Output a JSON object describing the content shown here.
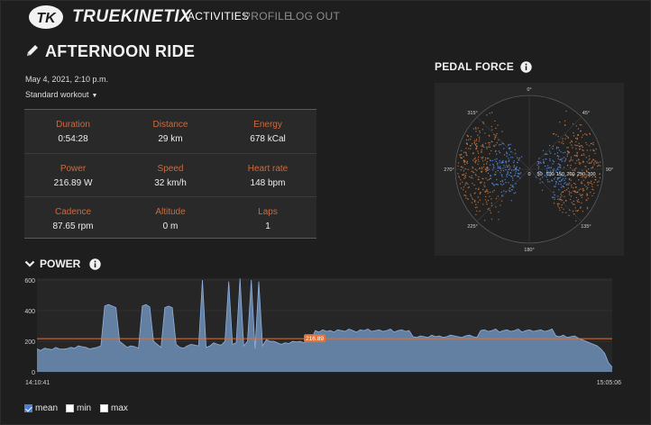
{
  "header": {
    "logo_text": "TK",
    "brand": "TRUEKINETIX",
    "nav": [
      {
        "label": "ACTIVITIES",
        "active": true
      },
      {
        "label": "PROFILE",
        "active": false
      },
      {
        "label": "LOG OUT",
        "active": false
      }
    ]
  },
  "activity": {
    "title": "AFTERNOON RIDE",
    "date": "May 4, 2021, 2:10 p.m.",
    "workout_type": "Standard workout"
  },
  "stats": [
    [
      {
        "label": "Duration",
        "value": "0:54:28"
      },
      {
        "label": "Distance",
        "value": "29 km"
      },
      {
        "label": "Energy",
        "value": "678 kCal"
      }
    ],
    [
      {
        "label": "Power",
        "value": "216.89 W"
      },
      {
        "label": "Speed",
        "value": "32 km/h"
      },
      {
        "label": "Heart rate",
        "value": "148 bpm"
      }
    ],
    [
      {
        "label": "Cadence",
        "value": "87.65 rpm"
      },
      {
        "label": "Altitude",
        "value": "0 m"
      },
      {
        "label": "Laps",
        "value": "1"
      }
    ]
  ],
  "pedal_force": {
    "title": "PEDAL FORCE",
    "info_icon": "info-icon",
    "angle_labels": [
      "0°",
      "45°",
      "90°",
      "135°",
      "180°",
      "225°",
      "270°",
      "315°"
    ],
    "radial_labels": [
      "0",
      "50",
      "100",
      "150",
      "200",
      "250",
      "300"
    ],
    "colors": {
      "left": "#d9844a",
      "right": "#5b8fe0"
    }
  },
  "power": {
    "title": "POWER",
    "collapse_icon": "chevron-down-icon",
    "info_icon": "info-icon",
    "legend": [
      {
        "label": "mean",
        "checked": true
      },
      {
        "label": "min",
        "checked": false
      },
      {
        "label": "max",
        "checked": false
      }
    ]
  },
  "chart_data": {
    "type": "area",
    "title": "",
    "xlabel": "",
    "ylabel": "",
    "ylim": [
      0,
      600
    ],
    "y_ticks": [
      "0",
      "200",
      "400",
      "600"
    ],
    "x_tick_labels": [
      "14:10:41",
      "15:05:06"
    ],
    "mean_value": 216.89,
    "mean_label": "216.89",
    "colors": {
      "fill": "#6f8fb8",
      "line": "#8fb0e0",
      "mean": "#e0733a"
    },
    "series": [
      {
        "values": [
          150,
          140,
          155,
          150,
          145,
          160,
          150,
          148,
          152,
          160,
          155,
          170,
          165,
          160,
          150,
          155,
          160,
          170,
          430,
          440,
          430,
          420,
          200,
          180,
          160,
          170,
          165,
          155,
          430,
          440,
          425,
          200,
          180,
          160,
          420,
          430,
          420,
          180,
          160,
          155,
          170,
          180,
          175,
          170,
          600,
          160,
          170,
          190,
          180,
          175,
          200,
          590,
          180,
          190,
          610,
          170,
          200,
          600,
          150,
          590,
          170,
          210,
          200,
          200,
          190,
          180,
          190,
          185,
          200,
          195,
          200,
          190,
          200,
          210,
          270,
          260,
          275,
          265,
          270,
          260,
          275,
          270,
          265,
          280,
          270,
          260,
          275,
          270,
          280,
          265,
          270,
          275,
          265,
          270,
          280,
          260,
          270,
          275,
          265,
          270,
          230,
          225,
          235,
          230,
          225,
          240,
          230,
          235,
          225,
          230,
          240,
          235,
          230,
          225,
          235,
          240,
          230,
          225,
          270,
          275,
          265,
          270,
          280,
          260,
          270,
          275,
          265,
          270,
          280,
          260,
          270,
          275,
          265,
          270,
          275,
          265,
          270,
          280,
          235,
          230,
          240,
          225,
          230,
          235,
          220,
          210,
          200,
          190,
          180,
          170,
          150,
          120,
          60,
          30
        ]
      }
    ]
  }
}
